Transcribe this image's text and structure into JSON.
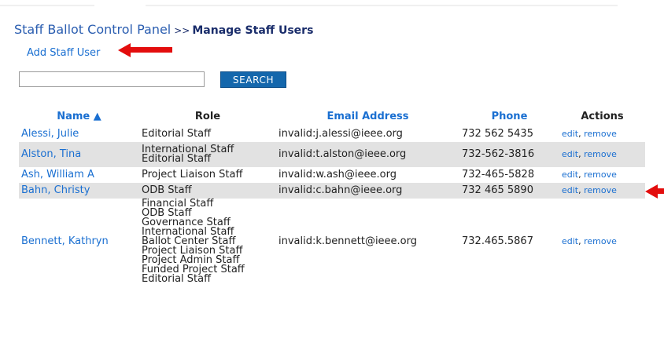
{
  "header": {
    "panel_title": "Staff Ballot Control Panel",
    "separator": ">>",
    "page_title": "Manage Staff Users"
  },
  "add_link": "Add Staff User",
  "search": {
    "button_label": "SEARCH",
    "value": ""
  },
  "table": {
    "columns": {
      "name": "Name ▲",
      "role": "Role",
      "email": "Email Address",
      "phone": "Phone",
      "actions": "Actions"
    },
    "rows": [
      {
        "name": "Alessi, Julie",
        "roles": [
          "Editorial Staff"
        ],
        "email": "invalid:j.alessi@ieee.org",
        "phone": "732 562 5435",
        "edit": "edit",
        "remove": "remove"
      },
      {
        "name": "Alston, Tina",
        "roles": [
          "International Staff",
          "Editorial Staff"
        ],
        "email": "invalid:t.alston@ieee.org",
        "phone": "732-562-3816",
        "edit": "edit",
        "remove": "remove"
      },
      {
        "name": "Ash, William A",
        "roles": [
          "Project Liaison Staff"
        ],
        "email": "invalid:w.ash@ieee.org",
        "phone": "732-465-5828",
        "edit": "edit",
        "remove": "remove"
      },
      {
        "name": "Bahn, Christy",
        "roles": [
          "ODB Staff"
        ],
        "email": "invalid:c.bahn@ieee.org",
        "phone": "732 465 5890",
        "edit": "edit",
        "remove": "remove"
      },
      {
        "name": "Bennett, Kathryn",
        "roles": [
          "Financial Staff",
          "ODB Staff",
          "Governance Staff",
          "International Staff",
          "Ballot Center Staff",
          "Project Liaison Staff",
          "Project Admin Staff",
          "Funded Project Staff",
          "Editorial Staff"
        ],
        "email": "invalid:k.bennett@ieee.org",
        "phone": "732.465.5867",
        "edit": "edit",
        "remove": "remove"
      }
    ]
  },
  "colors": {
    "link": "#1a6fd1",
    "title": "#2a5db0",
    "search_button": "#1467ac",
    "row_alt": "#e2e2e2",
    "annotation_arrow": "#e30d0d"
  }
}
